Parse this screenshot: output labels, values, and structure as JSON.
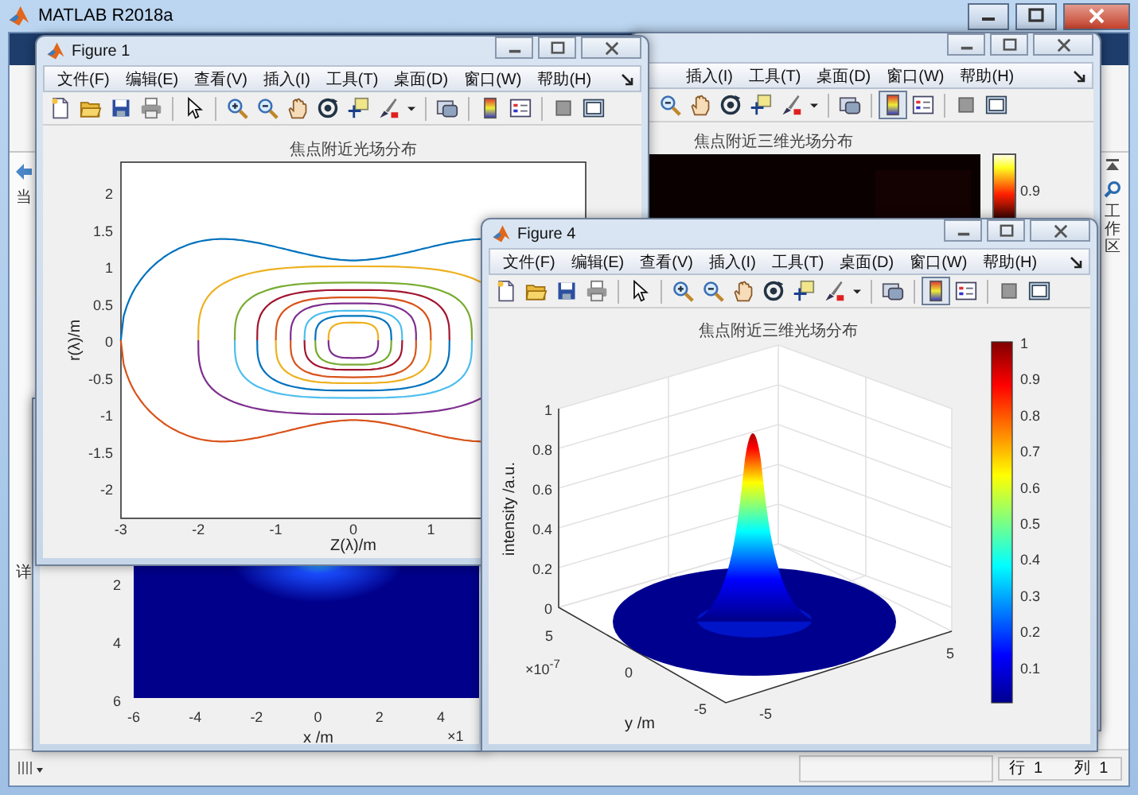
{
  "main_window": {
    "title": "MATLAB R2018a",
    "left_labels": [
      "当",
      "详"
    ],
    "workspace_label": "工作区",
    "status": {
      "row": "行  1",
      "column": "列  1"
    }
  },
  "back_figure": {
    "kind": "heatmap",
    "menu": [
      "插入(I)",
      "工具(T)",
      "桌面(D)",
      "窗口(W)",
      "帮助(H)"
    ],
    "colorbar_pressed": true,
    "axes": {
      "title": "焦点附近三维光场分布",
      "colorbar_ticks": [
        "0.9"
      ]
    }
  },
  "lower_figure": {
    "axes": {
      "xticks": [
        "-6",
        "-4",
        "-2",
        "0",
        "2",
        "4"
      ],
      "yticks": [
        "2",
        "4",
        "6"
      ],
      "xlabel": "x /m",
      "exponent": "×1"
    }
  },
  "figure_1": {
    "kind": "contour",
    "title": "Figure 1",
    "menu": [
      "文件(F)",
      "编辑(E)",
      "查看(V)",
      "插入(I)",
      "工具(T)",
      "桌面(D)",
      "窗口(W)",
      "帮助(H)"
    ],
    "colorbar_pressed": false,
    "axes": {
      "title": "焦点附近光场分布",
      "xticks": [
        "-3",
        "-2",
        "-1",
        "0",
        "1"
      ],
      "yticks": [
        "2",
        "1.5",
        "1",
        "0.5",
        "0",
        "-0.5",
        "-1",
        "-1.5",
        "-2"
      ],
      "xlabel": "Z(λ)/m",
      "ylabel": "r(λ)/m"
    }
  },
  "figure_4": {
    "kind": "surface",
    "title": "Figure 4",
    "menu": [
      "文件(F)",
      "编辑(E)",
      "查看(V)",
      "插入(I)",
      "工具(T)",
      "桌面(D)",
      "窗口(W)",
      "帮助(H)"
    ],
    "colorbar_pressed": true,
    "axes": {
      "title": "焦点附近三维光场分布",
      "zticks": [
        "1",
        "0.8",
        "0.6",
        "0.4",
        "0.2",
        "0"
      ],
      "yticks": [
        "5",
        "0",
        "-5"
      ],
      "xticks": [
        "-5",
        "5"
      ],
      "exponent": "×10$^{-7}$",
      "ylabel": "y /m",
      "zlabel": "intensity /a.u.",
      "colorbar_ticks": [
        "1",
        "0.9",
        "0.8",
        "0.7",
        "0.6",
        "0.5",
        "0.4",
        "0.3",
        "0.2",
        "0.1"
      ]
    }
  }
}
